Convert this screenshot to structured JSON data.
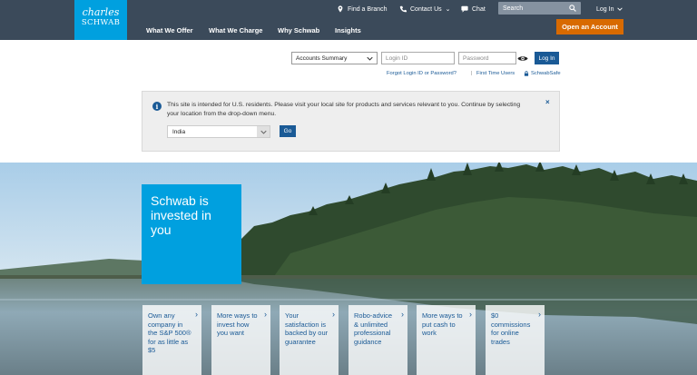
{
  "brand": {
    "line1": "charles",
    "line2": "SCHWAB"
  },
  "utility": {
    "find_branch": "Find a Branch",
    "contact_us": "Contact Us",
    "contact_caret": "⌄",
    "chat": "Chat",
    "search_placeholder": "Search",
    "log_in": "Log In"
  },
  "nav": [
    "What We Offer",
    "What We Charge",
    "Why Schwab",
    "Insights"
  ],
  "open_account": "Open an Account",
  "login": {
    "account_type": "Accounts Summary",
    "login_id_placeholder": "Login ID",
    "password_placeholder": "Password",
    "button": "Log In",
    "forgot": "Forgot Login ID or Password?",
    "separator": "|",
    "first_time": "First Time Users",
    "safe": "SchwabSafe"
  },
  "notice": {
    "text": "This site is intended for U.S. residents. Please visit your local site for products and services relevant to you. Continue by selecting your location from the drop-down menu.",
    "close": "×",
    "country": "India",
    "go": "Go"
  },
  "hero": {
    "tagline": "Schwab is invested in you",
    "cards": [
      "Own any company in the S&P 500® for as little as $5",
      "More ways to invest how you want",
      "Your satisfaction is backed by our guarantee",
      "Robo-advice & unlimited professional guidance",
      "More ways to put cash to work",
      "$0 commissions for online trades"
    ]
  },
  "colors": {
    "header": "#3b4a5a",
    "brand_blue": "#00a0df",
    "cta_orange": "#d86a00",
    "link_blue": "#1a5a96"
  }
}
